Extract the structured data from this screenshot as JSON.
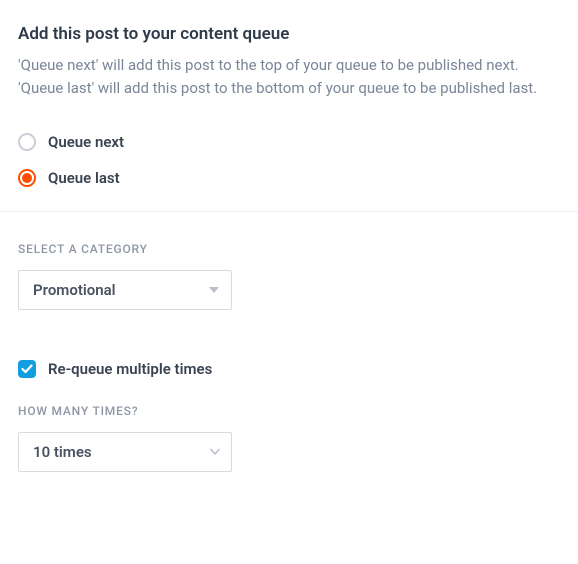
{
  "header": {
    "title": "Add this post to your content queue",
    "description": "'Queue next' will add this post to the top of your queue to be published next. 'Queue last' will add this post to the bottom of your queue to be published last."
  },
  "radios": {
    "next_label": "Queue next",
    "last_label": "Queue last",
    "selected": "last"
  },
  "category": {
    "section_label": "SELECT A CATEGORY",
    "value": "Promotional"
  },
  "requeue": {
    "checkbox_label": "Re-queue multiple times",
    "checked": true,
    "times_label": "HOW MANY TIMES?",
    "times_value": "10 times"
  },
  "colors": {
    "accent_radio": "#ff4e00",
    "accent_checkbox": "#139ee0"
  }
}
